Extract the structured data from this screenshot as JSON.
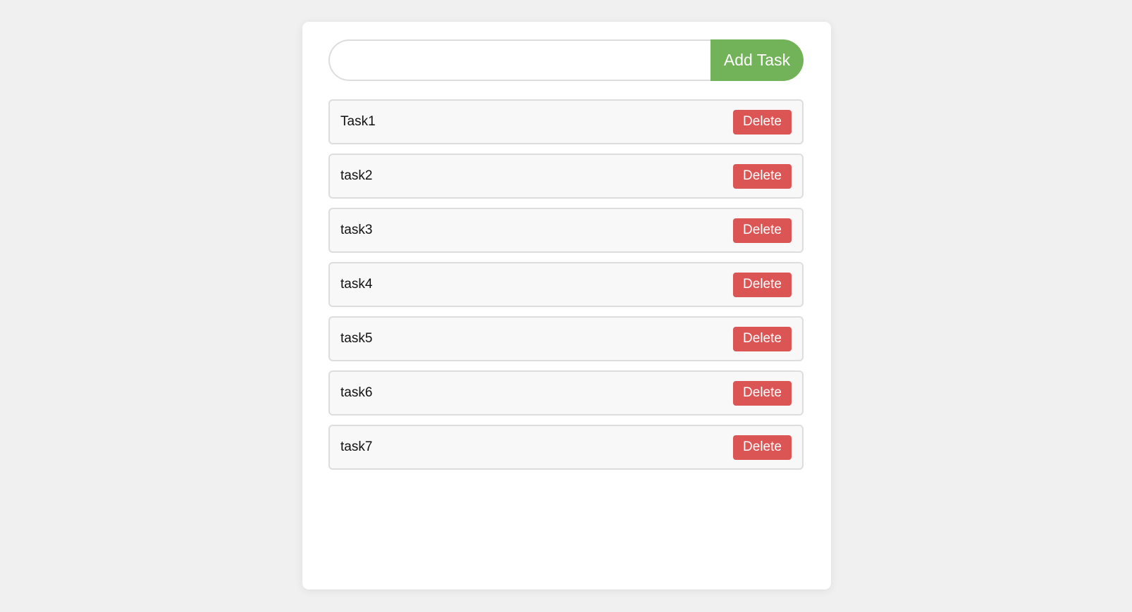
{
  "form": {
    "input_value": "",
    "input_placeholder": "",
    "add_label": "Add Task"
  },
  "tasks": [
    {
      "text": "Task1",
      "delete_label": "Delete"
    },
    {
      "text": "task2",
      "delete_label": "Delete"
    },
    {
      "text": "task3",
      "delete_label": "Delete"
    },
    {
      "text": "task4",
      "delete_label": "Delete"
    },
    {
      "text": "task5",
      "delete_label": "Delete"
    },
    {
      "text": "task6",
      "delete_label": "Delete"
    },
    {
      "text": "task7",
      "delete_label": "Delete"
    }
  ],
  "colors": {
    "add": "#72b259",
    "delete": "#dc5555"
  }
}
